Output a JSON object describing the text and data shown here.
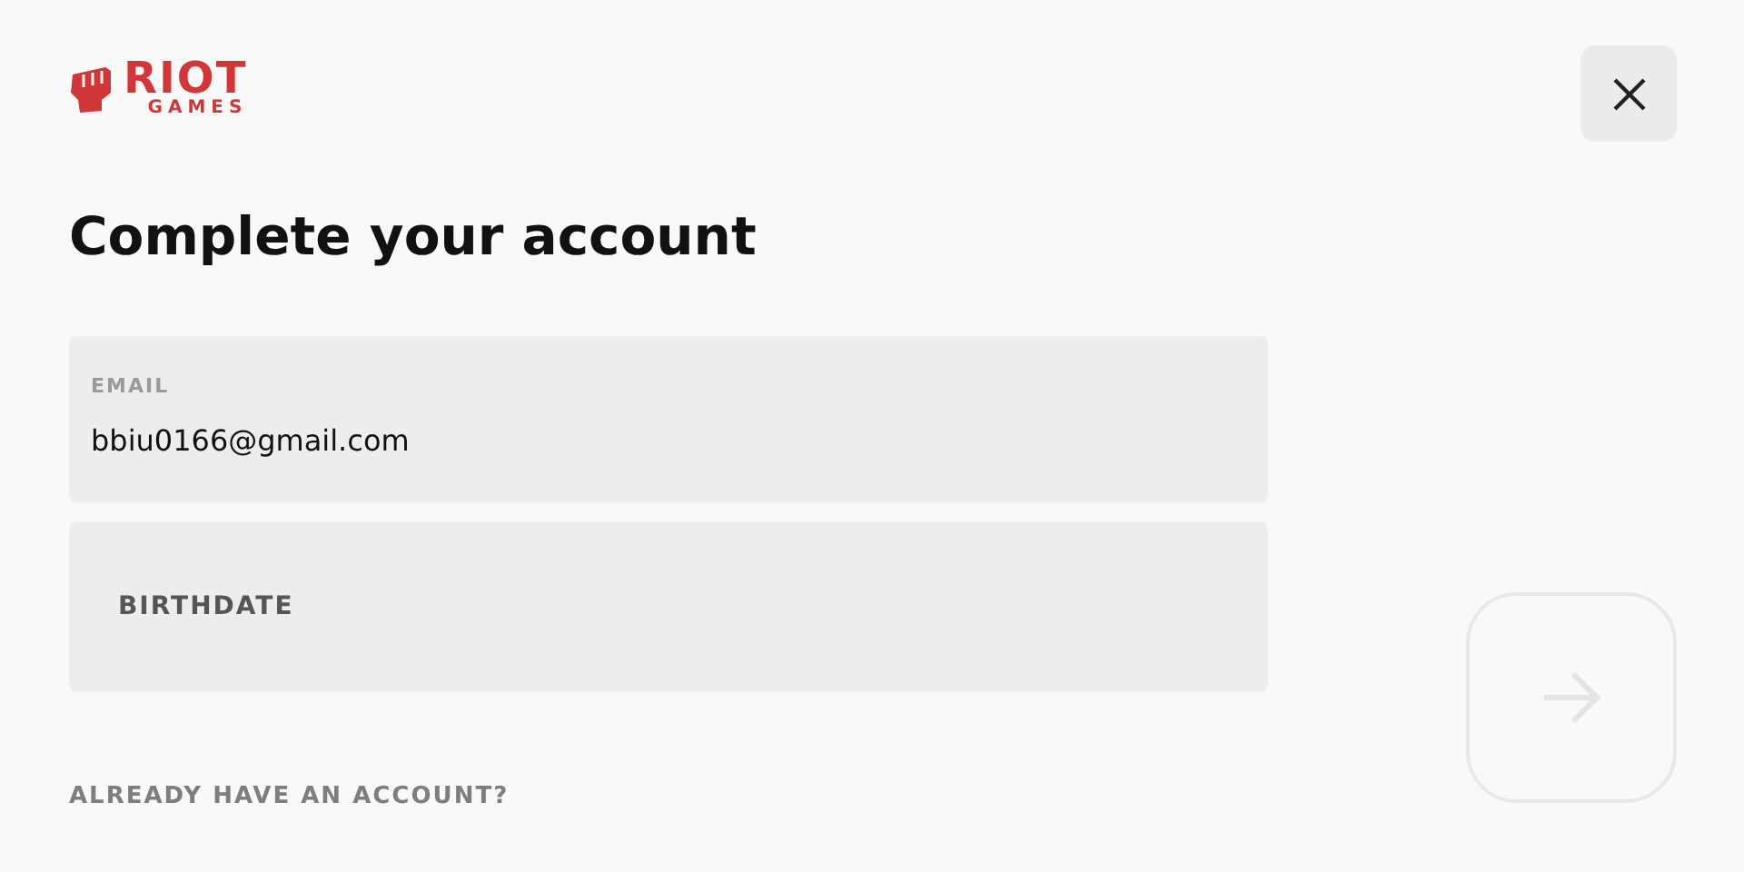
{
  "logo": {
    "line_1": "RIOT",
    "line_2": "GAMES"
  },
  "title": "Complete your account",
  "fields": [
    {
      "kind": "filled",
      "label": "EMAIL",
      "value": "bbiu0166@gmail.com"
    },
    {
      "kind": "empty",
      "label": "BIRTHDATE"
    }
  ],
  "link": "ALREADY HAVE AN ACCOUNT?",
  "next_button": {
    "disabled": true
  }
}
